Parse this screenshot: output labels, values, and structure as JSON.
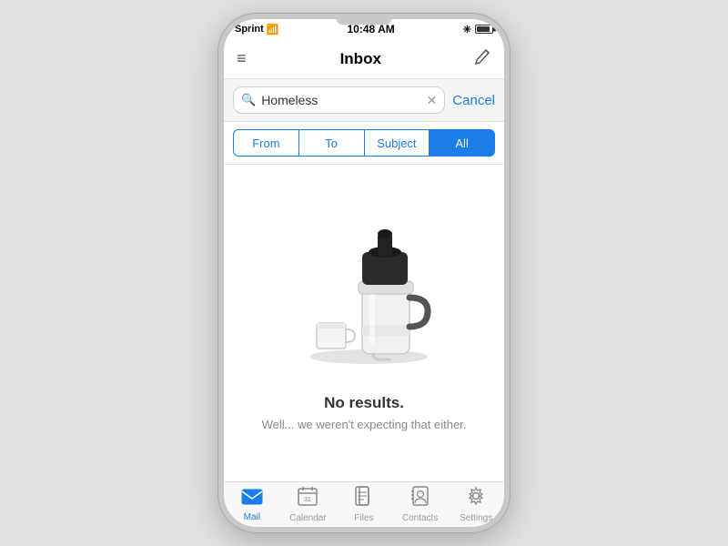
{
  "status_bar": {
    "carrier": "Sprint",
    "time": "10:48 AM",
    "signal_dots": 2,
    "empty_dots": 3
  },
  "nav": {
    "title": "Inbox",
    "hamburger_label": "≡",
    "compose_label": "✏"
  },
  "search": {
    "placeholder": "Search",
    "value": "Homeless",
    "cancel_label": "Cancel"
  },
  "filters": [
    {
      "id": "from",
      "label": "From",
      "active": false
    },
    {
      "id": "to",
      "label": "To",
      "active": false
    },
    {
      "id": "subject",
      "label": "Subject",
      "active": false
    },
    {
      "id": "all",
      "label": "All",
      "active": true
    }
  ],
  "empty_state": {
    "heading": "No results.",
    "subtext": "Well... we weren't expecting that either."
  },
  "tab_bar": {
    "items": [
      {
        "id": "mail",
        "label": "Mail",
        "active": true
      },
      {
        "id": "calendar",
        "label": "Calendar",
        "active": false
      },
      {
        "id": "files",
        "label": "Files",
        "active": false
      },
      {
        "id": "contacts",
        "label": "Contacts",
        "active": false
      },
      {
        "id": "settings",
        "label": "Settings",
        "active": false
      }
    ]
  }
}
